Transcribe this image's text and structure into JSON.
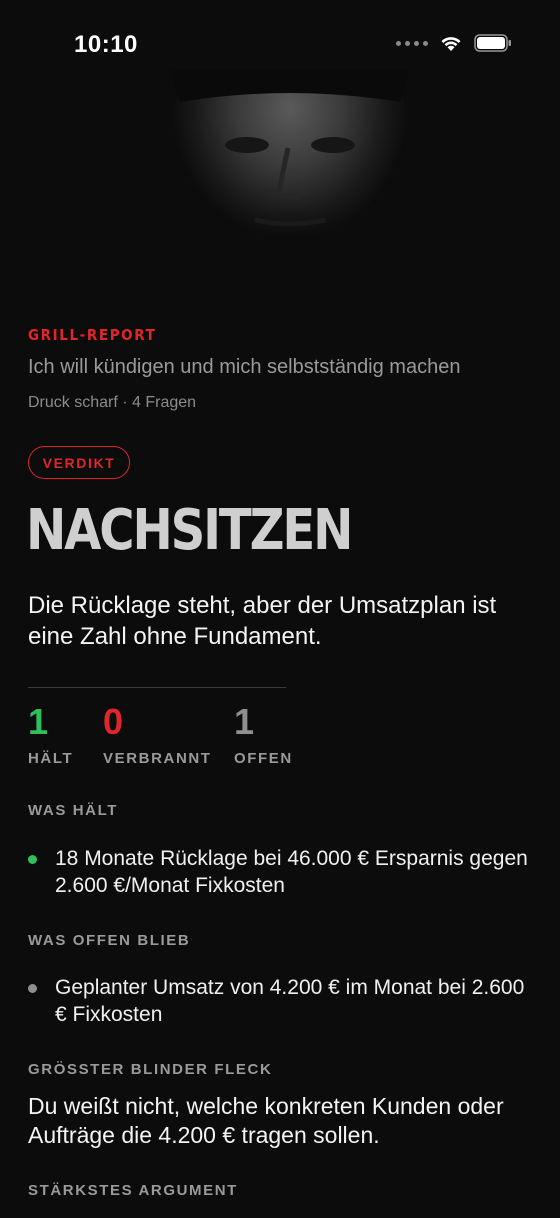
{
  "status_bar": {
    "time": "10:10"
  },
  "report": {
    "kicker": "GRILL-REPORT",
    "subtitle": "Ich will kündigen und mich selbstständig machen",
    "meta": "Druck scharf · 4 Fragen"
  },
  "verdict": {
    "badge": "VERDIKT",
    "title": "NACHSITZEN",
    "summary": "Die Rücklage steht, aber der Umsatzplan ist eine Zahl ohne Fundament."
  },
  "stats": [
    {
      "value": "1",
      "label": "HÄLT",
      "color": "#2fbf5c"
    },
    {
      "value": "0",
      "label": "VERBRANNT",
      "color": "#e0262b"
    },
    {
      "value": "1",
      "label": "OFFEN",
      "color": "#8f8f8f"
    }
  ],
  "sections": {
    "holds": {
      "label": "WAS HÄLT",
      "items": [
        "18 Monate Rücklage bei 46.000 € Ersparnis gegen 2.600 €/Monat Fixkosten"
      ],
      "dot_color": "#2fbf5c"
    },
    "open": {
      "label": "WAS OFFEN BLIEB",
      "items": [
        "Geplanter Umsatz von 4.200 € im Monat bei 2.600 € Fixkosten"
      ],
      "dot_color": "#8f8f8f"
    },
    "blind_spot": {
      "label": "GRÖSSTER BLINDER FLECK",
      "text": "Du weißt nicht, welche konkreten Kunden oder Aufträge die 4.200 € tragen sollen."
    },
    "strongest": {
      "label": "STÄRKSTES ARGUMENT"
    }
  },
  "icons": {
    "signal": "cellular-signal-icon",
    "wifi": "wifi-icon",
    "battery": "battery-icon"
  }
}
